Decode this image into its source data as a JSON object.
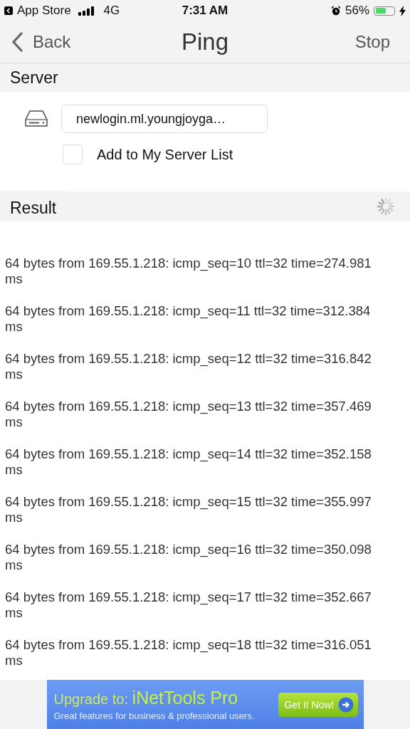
{
  "status_bar": {
    "back_app": "App Store",
    "network": "4G",
    "time": "7:31 AM",
    "battery": "56%"
  },
  "nav": {
    "back": "Back",
    "title": "Ping",
    "action": "Stop"
  },
  "server": {
    "heading": "Server",
    "host": "newlogin.ml.youngjoyga…",
    "add_to_list": {
      "label": "Add to My Server List",
      "checked": false
    }
  },
  "result": {
    "heading": "Result",
    "loading": true,
    "lines": [
      "64 bytes from 169.55.1.218: icmp_seq=10 ttl=32 time=274.981 ms",
      "64 bytes from 169.55.1.218: icmp_seq=11 ttl=32 time=312.384 ms",
      "64 bytes from 169.55.1.218: icmp_seq=12 ttl=32 time=316.842 ms",
      "64 bytes from 169.55.1.218: icmp_seq=13 ttl=32 time=357.469 ms",
      "64 bytes from 169.55.1.218: icmp_seq=14 ttl=32 time=352.158 ms",
      "64 bytes from 169.55.1.218: icmp_seq=15 ttl=32 time=355.997 ms",
      "64 bytes from 169.55.1.218: icmp_seq=16 ttl=32 time=350.098 ms",
      "64 bytes from 169.55.1.218: icmp_seq=17 ttl=32 time=352.667 ms",
      "64 bytes from 169.55.1.218: icmp_seq=18 ttl=32 time=316.051 ms"
    ]
  },
  "ad": {
    "headline_prefix": "Upgrade to:",
    "headline_product": "iNetTools Pro",
    "tagline": "Great features for business & professional users.",
    "button": "Get It Now!"
  }
}
